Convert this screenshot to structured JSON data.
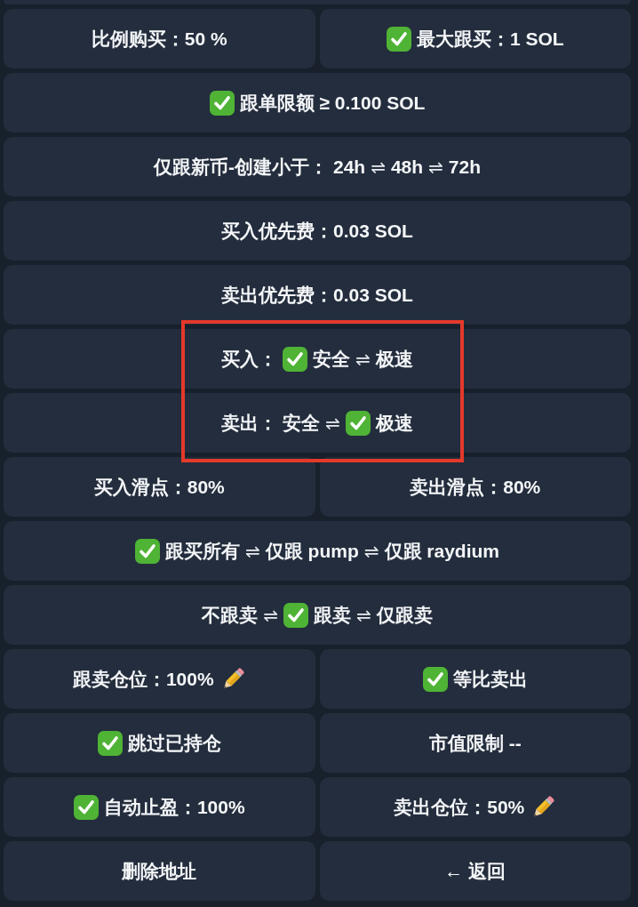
{
  "rows": [
    {
      "highlighted": false,
      "buttons": [
        {
          "kind": "plain",
          "label": "比例购买：50 %"
        },
        {
          "kind": "toggle",
          "label": "最大跟买：1 SOL",
          "checked": true
        }
      ]
    },
    {
      "highlighted": false,
      "buttons": [
        {
          "kind": "toggle",
          "label": "跟单限额 ≥ 0.100 SOL",
          "checked": true
        }
      ]
    },
    {
      "highlighted": false,
      "buttons": [
        {
          "kind": "choice",
          "prefix": "仅跟新币-创建小于：",
          "options": [
            {
              "label": "24h",
              "selected": false
            },
            {
              "separator": "⇌",
              "label": "48h",
              "selected": false
            },
            {
              "separator": "⇌",
              "label": "72h",
              "selected": false
            }
          ]
        }
      ]
    },
    {
      "highlighted": false,
      "buttons": [
        {
          "kind": "plain",
          "label": "买入优先费：0.03 SOL"
        }
      ]
    },
    {
      "highlighted": false,
      "buttons": [
        {
          "kind": "plain",
          "label": "卖出优先费：0.03 SOL"
        }
      ]
    },
    {
      "highlighted": true,
      "buttons": [
        {
          "kind": "choice",
          "prefix": "买入：",
          "options": [
            {
              "label": "安全",
              "selected": true
            },
            {
              "separator": "⇌",
              "label": "极速",
              "selected": false
            }
          ]
        }
      ]
    },
    {
      "highlighted": true,
      "buttons": [
        {
          "kind": "choice",
          "prefix": "卖出：",
          "options": [
            {
              "label": "安全",
              "selected": false
            },
            {
              "separator": "⇌",
              "label": "极速",
              "selected": true
            }
          ]
        }
      ]
    },
    {
      "highlighted": false,
      "buttons": [
        {
          "kind": "plain",
          "label": "买入滑点：80%"
        },
        {
          "kind": "plain",
          "label": "卖出滑点：80%"
        }
      ]
    },
    {
      "highlighted": false,
      "buttons": [
        {
          "kind": "choice",
          "options": [
            {
              "label": "跟买所有",
              "selected": true
            },
            {
              "separator": "⇌",
              "label": "仅跟 pump",
              "selected": false
            },
            {
              "separator": "⇌",
              "label": "仅跟 raydium",
              "selected": false
            }
          ]
        }
      ]
    },
    {
      "highlighted": false,
      "buttons": [
        {
          "kind": "choice",
          "options": [
            {
              "label": "不跟卖",
              "selected": false
            },
            {
              "separator": "⇌",
              "label": "跟卖",
              "selected": true
            },
            {
              "separator": "⇌",
              "label": "仅跟卖",
              "selected": false
            }
          ]
        }
      ]
    },
    {
      "highlighted": false,
      "buttons": [
        {
          "kind": "edit",
          "label": "跟卖仓位：100%"
        },
        {
          "kind": "toggle",
          "label": "等比卖出",
          "checked": true
        }
      ]
    },
    {
      "highlighted": false,
      "buttons": [
        {
          "kind": "toggle",
          "label": "跳过已持仓",
          "checked": true
        },
        {
          "kind": "plain",
          "label": "市值限制 --"
        }
      ]
    },
    {
      "highlighted": false,
      "buttons": [
        {
          "kind": "toggle",
          "label": "自动止盈：100%",
          "checked": true
        },
        {
          "kind": "edit",
          "label": "卖出仓位：50%"
        }
      ]
    },
    {
      "highlighted": false,
      "buttons": [
        {
          "kind": "plain",
          "label": "删除地址"
        },
        {
          "kind": "plain",
          "label": "← 返回"
        }
      ]
    }
  ]
}
